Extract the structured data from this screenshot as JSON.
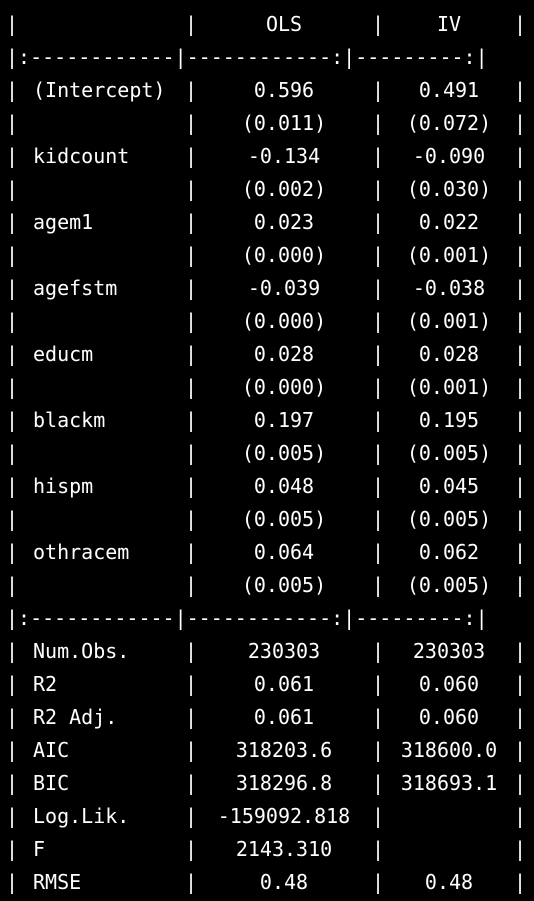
{
  "table": {
    "header": {
      "label": "",
      "ols": "OLS",
      "iv": "IV"
    },
    "separator": "|:------------|------------:|---------:|",
    "coef_rows": [
      {
        "label": "(Intercept)",
        "ols": "0.596",
        "iv": "0.491"
      },
      {
        "label": "",
        "ols": "(0.011)",
        "iv": "(0.072)"
      },
      {
        "label": "kidcount",
        "ols": "-0.134",
        "iv": "-0.090"
      },
      {
        "label": "",
        "ols": "(0.002)",
        "iv": "(0.030)"
      },
      {
        "label": "agem1",
        "ols": "0.023",
        "iv": "0.022"
      },
      {
        "label": "",
        "ols": "(0.000)",
        "iv": "(0.001)"
      },
      {
        "label": "agefstm",
        "ols": "-0.039",
        "iv": "-0.038"
      },
      {
        "label": "",
        "ols": "(0.000)",
        "iv": "(0.001)"
      },
      {
        "label": "educm",
        "ols": "0.028",
        "iv": "0.028"
      },
      {
        "label": "",
        "ols": "(0.000)",
        "iv": "(0.001)"
      },
      {
        "label": "blackm",
        "ols": "0.197",
        "iv": "0.195"
      },
      {
        "label": "",
        "ols": "(0.005)",
        "iv": "(0.005)"
      },
      {
        "label": "hispm",
        "ols": "0.048",
        "iv": "0.045"
      },
      {
        "label": "",
        "ols": "(0.005)",
        "iv": "(0.005)"
      },
      {
        "label": "othracem",
        "ols": "0.064",
        "iv": "0.062"
      },
      {
        "label": "",
        "ols": "(0.005)",
        "iv": "(0.005)"
      }
    ],
    "stat_rows": [
      {
        "label": "Num.Obs.",
        "ols": "230303",
        "iv": "230303"
      },
      {
        "label": "R2",
        "ols": "0.061",
        "iv": "0.060"
      },
      {
        "label": "R2 Adj.",
        "ols": "0.061",
        "iv": "0.060"
      },
      {
        "label": "AIC",
        "ols": "318203.6",
        "iv": "318600.0"
      },
      {
        "label": "BIC",
        "ols": "318296.8",
        "iv": "318693.1"
      },
      {
        "label": "Log.Lik.",
        "ols": "-159092.818",
        "iv": ""
      },
      {
        "label": "F",
        "ols": "2143.310",
        "iv": ""
      },
      {
        "label": "RMSE",
        "ols": "0.48",
        "iv": "0.48"
      }
    ]
  }
}
